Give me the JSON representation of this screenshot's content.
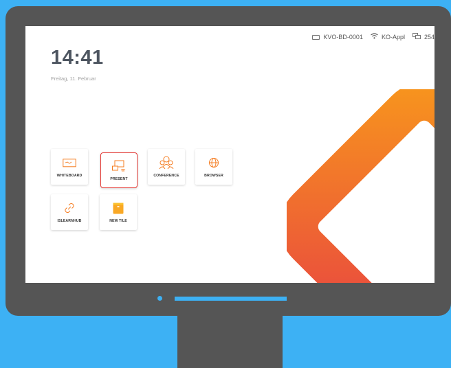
{
  "status": {
    "device_name": "KVO-BD-0001",
    "network": "KO-Appl",
    "storage": "254"
  },
  "clock": {
    "time": "14:41",
    "date": "Freitag, 11. Februar"
  },
  "tiles": [
    {
      "label": "WHITEBOARD",
      "icon": "whiteboard-icon"
    },
    {
      "label": "PRESENT",
      "icon": "present-icon",
      "selected": true
    },
    {
      "label": "CONFERENCE",
      "icon": "conference-icon"
    },
    {
      "label": "BROWSER",
      "icon": "globe-icon"
    },
    {
      "label": "ISLEARNHUB",
      "icon": "link-icon"
    },
    {
      "label": "NEW TILE",
      "icon": "new-tile-icon"
    }
  ],
  "colors": {
    "background": "#3db1f4",
    "bezel": "#555555",
    "accent": "#f57c20",
    "selected_border": "#e53935"
  }
}
